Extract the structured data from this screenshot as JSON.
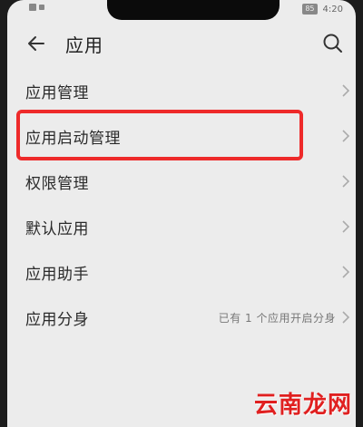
{
  "status_bar": {
    "time": "4:20",
    "battery_badge": "85"
  },
  "app_bar": {
    "title": "应用",
    "back_icon": "back-arrow-icon",
    "search_icon": "search-icon"
  },
  "items": [
    {
      "label": "应用管理",
      "value": ""
    },
    {
      "label": "应用启动管理",
      "value": ""
    },
    {
      "label": "权限管理",
      "value": ""
    },
    {
      "label": "默认应用",
      "value": ""
    },
    {
      "label": "应用助手",
      "value": ""
    },
    {
      "label": "应用分身",
      "value": "已有 1 个应用开启分身"
    }
  ],
  "highlight_color": "#ee2a2a",
  "watermark": "云南龙网"
}
